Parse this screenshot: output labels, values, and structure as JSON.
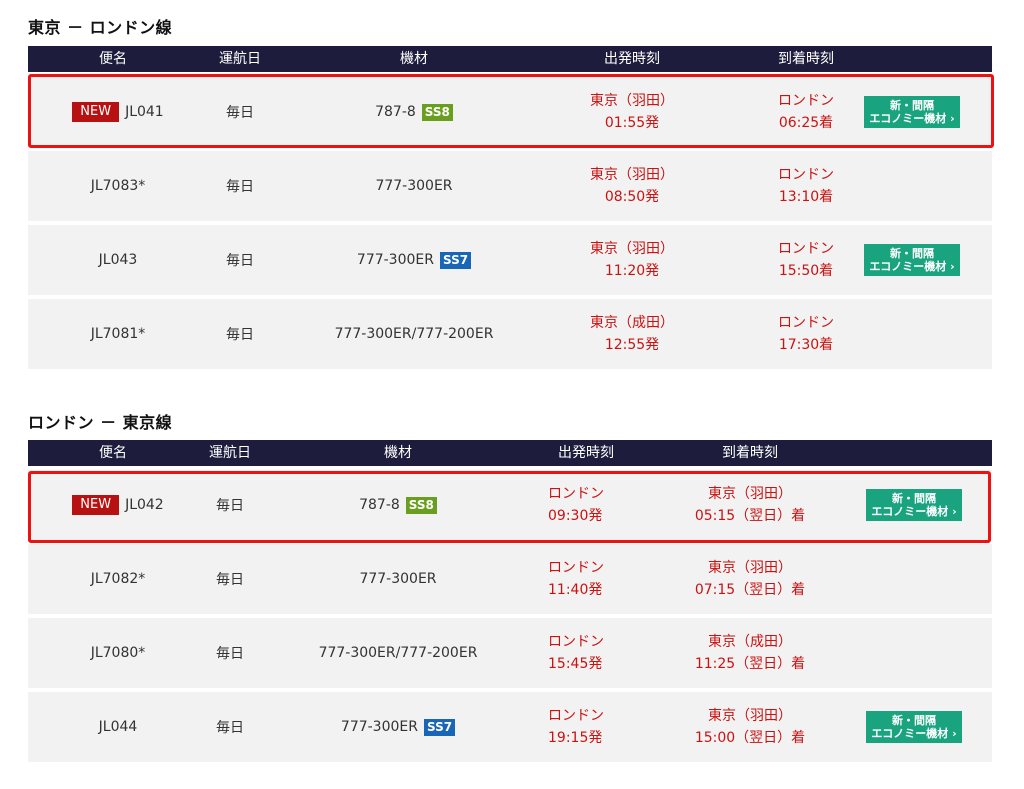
{
  "sections": [
    {
      "title": "東京 － ロンドン線",
      "headers": [
        "便名",
        "運航日",
        "機材",
        "出発時刻",
        "到着時刻"
      ],
      "rows": [
        {
          "new": "NEW",
          "flight": "JL041",
          "days": "毎日",
          "aircraft": "787-8",
          "ss": "SS8",
          "ss_color": "#6a9e1f",
          "dep_place": "東京（羽田）",
          "dep_time": "01:55発",
          "arr_place": "ロンドン",
          "arr_time": "06:25着",
          "btn1": "新・間隔",
          "btn2": "エコノミー機材 ›"
        },
        {
          "new": "",
          "flight": "JL7083*",
          "days": "毎日",
          "aircraft": "777-300ER",
          "ss": "",
          "ss_color": "",
          "dep_place": "東京（羽田）",
          "dep_time": "08:50発",
          "arr_place": "ロンドン",
          "arr_time": "13:10着",
          "btn1": "",
          "btn2": ""
        },
        {
          "new": "",
          "flight": "JL043",
          "days": "毎日",
          "aircraft": "777-300ER",
          "ss": "SS7",
          "ss_color": "#1866b5",
          "dep_place": "東京（羽田）",
          "dep_time": "11:20発",
          "arr_place": "ロンドン",
          "arr_time": "15:50着",
          "btn1": "新・間隔",
          "btn2": "エコノミー機材 ›"
        },
        {
          "new": "",
          "flight": "JL7081*",
          "days": "毎日",
          "aircraft": "777-300ER/777-200ER",
          "ss": "",
          "ss_color": "",
          "dep_place": "東京（成田）",
          "dep_time": "12:55発",
          "arr_place": "ロンドン",
          "arr_time": "17:30着",
          "btn1": "",
          "btn2": ""
        }
      ]
    },
    {
      "title": "ロンドン － 東京線",
      "headers": [
        "便名",
        "運航日",
        "機材",
        "出発時刻",
        "到着時刻"
      ],
      "rows": [
        {
          "new": "NEW",
          "flight": "JL042",
          "days": "毎日",
          "aircraft": "787-8",
          "ss": "SS8",
          "ss_color": "#6a9e1f",
          "dep_place": "ロンドン",
          "dep_time": "09:30発",
          "arr_place": "東京（羽田）",
          "arr_time": "05:15（翌日）着",
          "btn1": "新・間隔",
          "btn2": "エコノミー機材 ›"
        },
        {
          "new": "",
          "flight": "JL7082*",
          "days": "毎日",
          "aircraft": "777-300ER",
          "ss": "",
          "ss_color": "",
          "dep_place": "ロンドン",
          "dep_time": "11:40発",
          "arr_place": "東京（羽田）",
          "arr_time": "07:15（翌日）着",
          "btn1": "",
          "btn2": ""
        },
        {
          "new": "",
          "flight": "JL7080*",
          "days": "毎日",
          "aircraft": "777-300ER/777-200ER",
          "ss": "",
          "ss_color": "",
          "dep_place": "ロンドン",
          "dep_time": "15:45発",
          "arr_place": "東京（成田）",
          "arr_time": "11:25（翌日）着",
          "btn1": "",
          "btn2": ""
        },
        {
          "new": "",
          "flight": "JL044",
          "days": "毎日",
          "aircraft": "777-300ER",
          "ss": "SS7",
          "ss_color": "#1866b5",
          "dep_place": "ロンドン",
          "dep_time": "19:15発",
          "arr_place": "東京（羽田）",
          "arr_time": "15:00（翌日）着",
          "btn1": "新・間隔",
          "btn2": "エコノミー機材 ›"
        }
      ]
    }
  ],
  "colors": {
    "header_bg": "#1d1c3d",
    "row_bg": "#f2f2f2",
    "time_text": "#cc1111",
    "new_badge": "#b71111",
    "eco_button": "#1aa37f",
    "highlight_border": "#ee1111"
  }
}
